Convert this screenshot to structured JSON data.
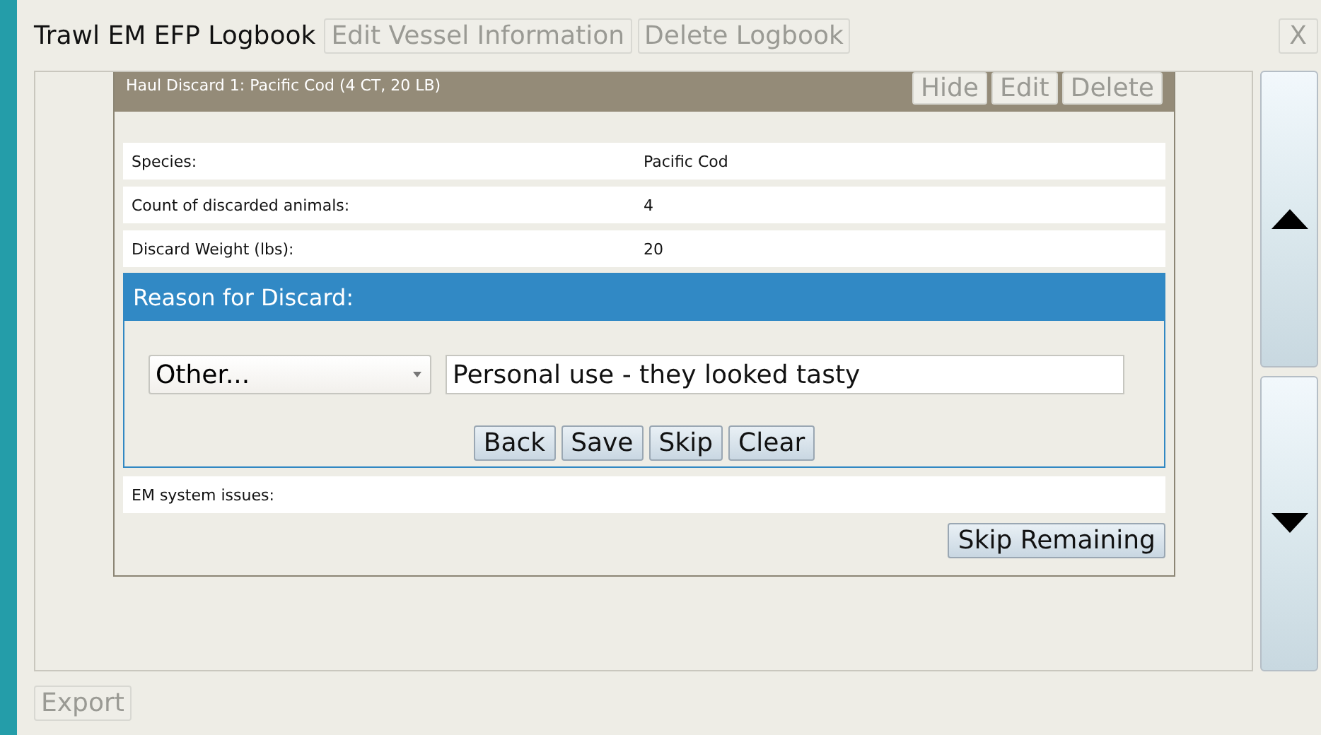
{
  "window": {
    "title": "Trawl EM EFP Logbook",
    "close": {
      "label": "X",
      "disabled": true
    }
  },
  "toolbar": [
    {
      "label": "Edit Vessel Information",
      "disabled": true
    },
    {
      "label": "Delete Logbook",
      "disabled": true
    }
  ],
  "card": {
    "title": "Haul Discard 1: Pacific Cod (4 CT, 20 LB)",
    "actions": [
      {
        "label": "Hide",
        "disabled": true
      },
      {
        "label": "Edit",
        "disabled": true
      },
      {
        "label": "Delete",
        "disabled": true
      }
    ],
    "fields": [
      {
        "label": "Species:",
        "value": "Pacific Cod"
      },
      {
        "label": "Count of discarded animals:",
        "value": "4"
      },
      {
        "label": "Discard Weight (lbs):",
        "value": "20"
      }
    ],
    "reason": {
      "title": "Reason for Discard:",
      "select": "Other...",
      "text": "Personal use - they looked tasty",
      "buttons": [
        {
          "label": "Back",
          "disabled": false
        },
        {
          "label": "Save",
          "disabled": false
        },
        {
          "label": "Skip",
          "disabled": false
        },
        {
          "label": "Clear",
          "disabled": false
        }
      ]
    },
    "after_fields": [
      {
        "label": "EM system issues:"
      }
    ],
    "skip_button": {
      "label": "Skip Remaining",
      "disabled": false
    }
  },
  "export": {
    "label": "Export",
    "disabled": true
  }
}
